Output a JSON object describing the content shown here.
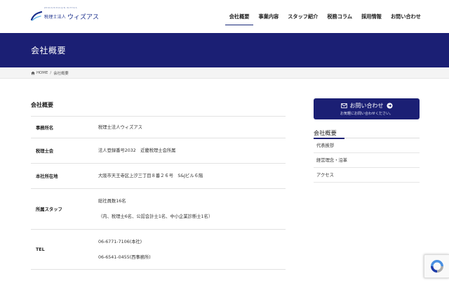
{
  "header": {
    "logo_small": "税理士法人",
    "logo_main": "ウィズアス",
    "logo_sub": "ZEIRISHIHOUJIN WITHUS",
    "nav": [
      {
        "label": "会社概要",
        "active": true
      },
      {
        "label": "事業内容",
        "active": false
      },
      {
        "label": "スタッフ紹介",
        "active": false
      },
      {
        "label": "税務コラム",
        "active": false
      },
      {
        "label": "採用情報",
        "active": false
      },
      {
        "label": "お問い合わせ",
        "active": false
      }
    ]
  },
  "banner": {
    "title": "会社概要"
  },
  "breadcrumb": {
    "home": "HOME",
    "separator": "/",
    "current": "会社概要"
  },
  "main": {
    "section_title": "会社概要",
    "rows": [
      {
        "label": "事務所名",
        "lines": [
          "税理士法人ウィズアス"
        ]
      },
      {
        "label": "税理士会",
        "lines": [
          "法人登録番号2032　近畿税理士会所属"
        ]
      },
      {
        "label": "本社所在地",
        "lines": [
          "大阪市天王寺区上汐三丁目８番２６号　S&Jビル６階"
        ]
      },
      {
        "label": "所属スタッフ",
        "lines": [
          "総社員数16名",
          "（内、税理士6名、公認会計士1名、中小企業診断士1名）"
        ]
      },
      {
        "label": "TEL",
        "lines": [
          "06-6771-7106(本社)",
          "06-6541-0455(西事務所)"
        ]
      }
    ]
  },
  "sidebar": {
    "cta_label": "お問い合わせ",
    "cta_sub": "お気軽にお問い合わせください。",
    "title": "会社概要",
    "items": [
      "代表挨拶",
      "経営理念・沿革",
      "アクセス"
    ]
  },
  "colors": {
    "brand": "#1b1f74",
    "accent": "#1a2f8c"
  },
  "icons": {
    "logo": "brand-wave-icon",
    "home": "home-icon",
    "mail": "mail-icon",
    "arrow": "arrow-circle-right-icon",
    "recaptcha": "recaptcha-icon"
  }
}
